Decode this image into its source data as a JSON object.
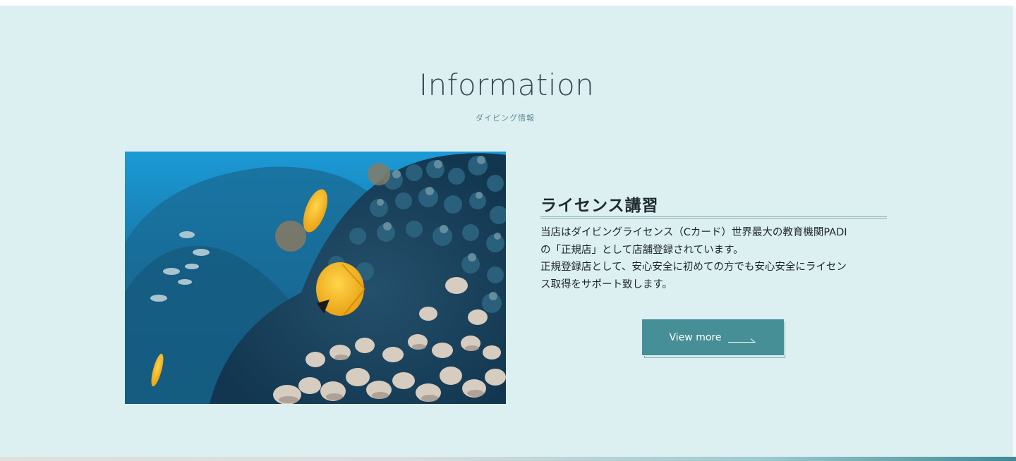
{
  "information": {
    "title": "Information",
    "subtitle": "ダイビング情報"
  },
  "card": {
    "image_alt": "coral reef with yellow butterflyfish",
    "title": "ライセンス講習",
    "body_lines": [
      "当店はダイビングライセンス（Cカード）世界最大の教育機関PADI",
      "の「正規店」として店舗登録されています。",
      "正規登録店として、安心安全に初めての方でも安心安全にライセン",
      "ス取得をサポート致します。"
    ],
    "button_label": "View more",
    "button_icon": "arrow-right-icon"
  },
  "colors": {
    "section_bg": "#dcf0f2",
    "accent": "#468f96",
    "heading": "#3a4a56"
  }
}
